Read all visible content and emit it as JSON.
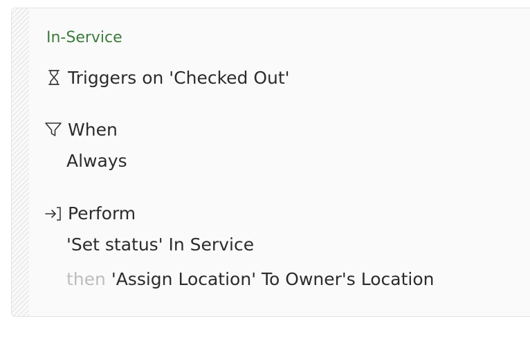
{
  "rule": {
    "title": "In-Service",
    "trigger": {
      "icon": "hourglass-icon",
      "label": "Triggers on 'Checked Out'"
    },
    "condition": {
      "icon": "filter-icon",
      "heading": "When",
      "value": "Always"
    },
    "action": {
      "icon": "sign-in-arrow-icon",
      "heading": "Perform",
      "steps": [
        {
          "text": "'Set status' In Service"
        },
        {
          "connector": "then",
          "text": "'Assign Location' To Owner's Location"
        }
      ]
    }
  },
  "colors": {
    "title": "#3c7a3c",
    "text": "#2b2b2b",
    "muted": "#bdbdbd"
  }
}
